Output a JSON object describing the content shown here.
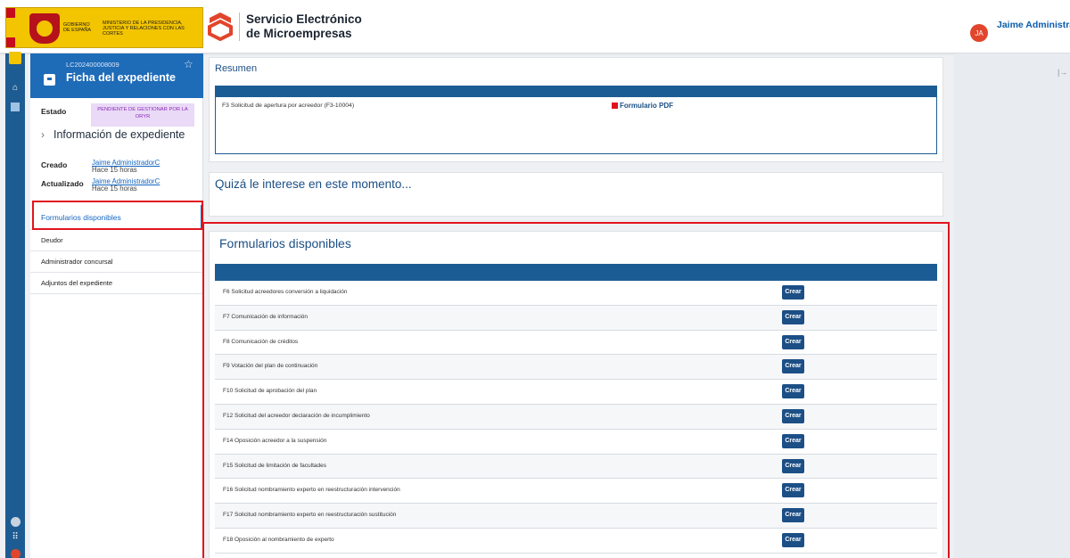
{
  "header": {
    "gov_line1": "GOBIERNO DE ESPAÑA",
    "gov_line2": "MINISTERIO DE LA PRESIDENCIA, JUSTICIA Y RELACIONES CON LAS CORTES",
    "brand_line1": "Servicio Electrónico",
    "brand_line2": "de Microempresas",
    "user_initials": "JA",
    "user_name": "Jaime Administrador"
  },
  "case": {
    "id": "LC202400008009",
    "title": "Ficha del expediente",
    "estado_label": "Estado",
    "estado_value": "PENDIENTE DE GESTIONAR POR LA ORYR",
    "info_title": "Información de expediente",
    "created_label": "Creado",
    "created_by": "Jaime AdministradorC",
    "created_when": "Hace 15 horas",
    "updated_label": "Actualizado",
    "updated_by": "Jaime AdministradorC",
    "updated_when": "Hace 15 horas"
  },
  "sidebar": {
    "items": [
      {
        "label": "Formularios disponibles",
        "active": true
      },
      {
        "label": "Deudor"
      },
      {
        "label": "Administrador concursal"
      },
      {
        "label": "Adjuntos del expediente"
      }
    ]
  },
  "resumen": {
    "title": "Resumen",
    "row_text": "F3 Solicitud de apertura por acreedor (F3-10004)",
    "pdf_label": "Formulario PDF"
  },
  "interes": {
    "title": "Quizá le interese en este momento..."
  },
  "formularios": {
    "title": "Formularios disponibles",
    "button_label": "Crear",
    "rows": [
      "F6 Solicitud acreedores conversión a liquidación",
      "F7 Comunicación de información",
      "F8 Comunicación de créditos",
      "F9 Votación del plan de continuación",
      "F10 Solicitud de aprobación del plan",
      "F12 Solicitud del acreedor declaración de incumplimiento",
      "F14 Oposición acreedor a la suspensión",
      "F15 Solicitud de limitación de facultades",
      "F16 Solicitud nombramiento experto en reestructuración intervención",
      "F17 Solicitud nombramiento experto en reestructuración sustitución",
      "F18 Oposición al nombramiento de experto"
    ]
  },
  "colors": {
    "primary": "#1e6bb8",
    "table_header": "#1c5c94",
    "highlight": "#e0141e",
    "badge_bg": "#ead9f7",
    "badge_text": "#8a2bb5"
  }
}
